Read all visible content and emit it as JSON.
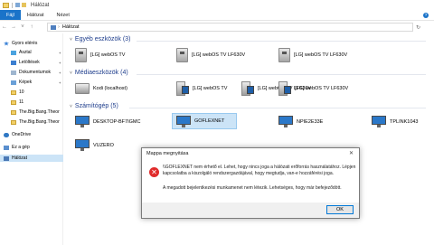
{
  "window": {
    "title": "Hálózat"
  },
  "ribbon": {
    "tabs": [
      "Fájl",
      "Hálózat",
      "Nézet"
    ]
  },
  "address": {
    "path": "Hálózat"
  },
  "sidebar": {
    "items": [
      {
        "label": "Gyors elérés",
        "icon": "star-icon"
      },
      {
        "label": "Asztal",
        "icon": "desktop-icon",
        "pinned": true
      },
      {
        "label": "Letöltések",
        "icon": "download-icon",
        "pinned": true
      },
      {
        "label": "Dokumentumok",
        "icon": "documents-icon",
        "pinned": true
      },
      {
        "label": "Képek",
        "icon": "pictures-icon",
        "pinned": true
      },
      {
        "label": "10",
        "icon": "folder-icon"
      },
      {
        "label": "11",
        "icon": "folder-icon"
      },
      {
        "label": "The.Big.Bang.Theor",
        "icon": "folder-icon"
      },
      {
        "label": "The.Big.Bang.Theor",
        "icon": "folder-icon"
      },
      {
        "label": "OneDrive",
        "icon": "onedrive-icon"
      },
      {
        "label": "Ez a gép",
        "icon": "this-pc-icon"
      },
      {
        "label": "Hálózat",
        "icon": "network-icon",
        "selected": true
      }
    ]
  },
  "groups": {
    "other": {
      "title": "Egyéb eszközök (3)",
      "items": [
        "[LG] webOS TV",
        "[LG] webOS TV LF630V",
        "[LG] webOS TV LF630V"
      ]
    },
    "media": {
      "title": "Médiaeszközök (4)",
      "items": [
        "Kodi (localhost)",
        "[LG] webOS TV",
        "[LG] webOS TV LF630V",
        "[LG] webOS TV LF630V"
      ]
    },
    "computers": {
      "title": "Számítógép (5)",
      "items": [
        "DESKTOP-BF7IGMC",
        "GOFLEXNET",
        "NPIE2E33E",
        "TPLINK1043",
        "VUZERO"
      ]
    }
  },
  "dialog": {
    "title": "Mappa megnyitása",
    "message": "\\\\GOFLEXNET nem érhető el. Lehet, hogy nincs joga a hálózati erőforrás használatához. Lépjen kapcsolatba a kiszolgáló rendszergazdájával, hogy megtudja, van-e hozzáférési joga.",
    "detail": "A megadott bejelentkezési munkamenet nem létezik. Lehetséges, hogy már befejeződött.",
    "ok_label": "OK"
  }
}
